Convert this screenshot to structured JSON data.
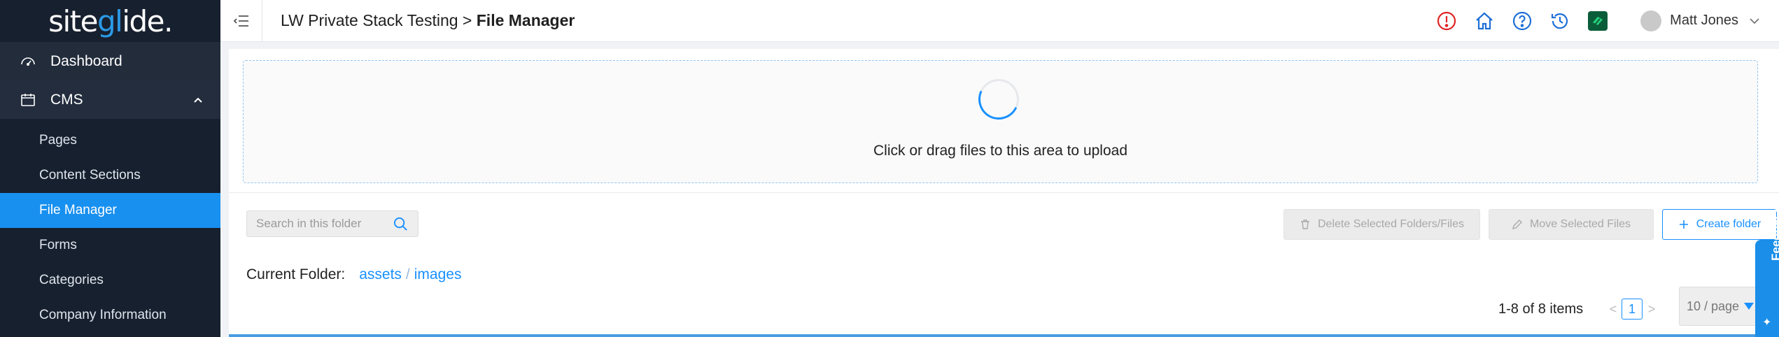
{
  "sidebar": {
    "logo_main": "site",
    "logo_accent": "gl",
    "logo_rest": "ide.",
    "items": [
      {
        "label": "Dashboard",
        "icon": "dashboard-icon"
      },
      {
        "label": "CMS",
        "icon": "calendar-icon",
        "expanded": true
      }
    ],
    "cms_children": [
      {
        "label": "Pages"
      },
      {
        "label": "Content Sections"
      },
      {
        "label": "File Manager",
        "active": true
      },
      {
        "label": "Forms"
      },
      {
        "label": "Categories"
      },
      {
        "label": "Company Information"
      }
    ]
  },
  "header": {
    "site_name": "LW Private Stack Testing",
    "separator": " > ",
    "page_title": "File Manager",
    "icons": [
      "alert-icon",
      "home-icon",
      "help-icon",
      "history-icon",
      "app-logo-icon"
    ],
    "user_name": "Matt Jones"
  },
  "upload": {
    "text": "Click or drag files to this area to upload"
  },
  "toolbar": {
    "search_placeholder": "Search in this folder",
    "delete_label": "Delete Selected Folders/Files",
    "move_label": "Move Selected Files",
    "create_label": "Create folder"
  },
  "folder": {
    "label": "Current Folder:",
    "path": [
      "assets",
      "images"
    ],
    "separator": "/"
  },
  "pagination": {
    "summary": "1-8 of 8 items",
    "prev": "<",
    "current_page": "1",
    "next": ">",
    "page_size": "10 / page"
  },
  "feedback": {
    "label": "Feedback"
  },
  "colors": {
    "sidebar_bg": "#17202e",
    "accent": "#1890ff",
    "active_item": "#1890ef",
    "alert": "#e02424",
    "brand_green": "#0f9d58"
  }
}
